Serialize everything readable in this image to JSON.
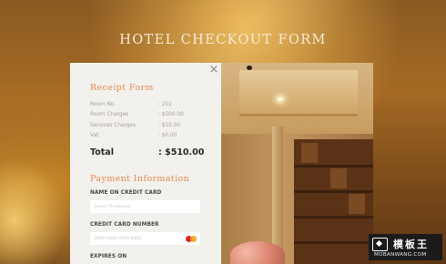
{
  "page": {
    "title": "HOTEL CHECKOUT FORM"
  },
  "dialog": {
    "close_icon": "close-icon",
    "close_glyph": "×"
  },
  "receipt": {
    "heading": "Receipt Form",
    "rows": [
      {
        "label": "Room No.",
        "value": ": 201"
      },
      {
        "label": "Room Charges",
        "value": ": $500.00"
      },
      {
        "label": "Services Charges",
        "value": ": $10.00"
      },
      {
        "label": "Vat",
        "value": ": $0.00"
      }
    ],
    "total_label": "Total",
    "total_value": ": $510.00"
  },
  "payment": {
    "heading": "Payment Information",
    "name_label": "NAME ON CREDIT CARD",
    "name_placeholder": "James Thompson",
    "card_label": "CREDIT CARD NUMBER",
    "card_placeholder": "0000 0000 0000 0000",
    "card_icon": "mastercard-icon",
    "expires_label": "EXPIRES ON"
  },
  "watermark": {
    "cn": "模板王",
    "en": "MOBANWANG.COM"
  },
  "colors": {
    "accent": "#e88a4a",
    "panel": "#f3f1ee"
  }
}
